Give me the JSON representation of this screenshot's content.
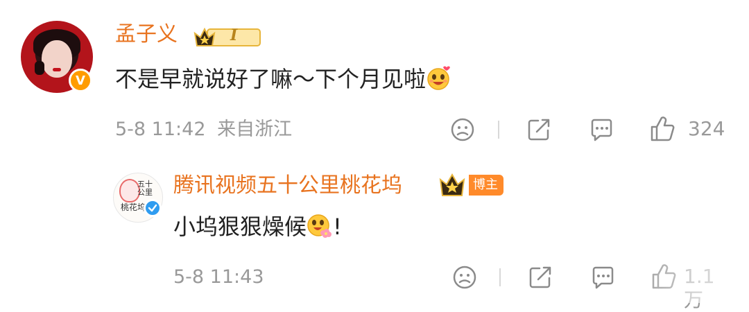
{
  "comment": {
    "author": "孟子义",
    "level_badge": "I",
    "text": "不是早就说好了嘛～下个月见啦",
    "time": "5-8 11:42",
    "location": "来自浙江",
    "likes": "324",
    "avatar_badge": "V"
  },
  "reply": {
    "author": "腾讯视频五十公里桃花坞",
    "author_tag": "博主",
    "text_before": "小坞狠狠燥候",
    "text_after": "!",
    "time": "5-8 11:43",
    "likes": "1.1万",
    "avatar_logo_top": "五十公里",
    "avatar_logo_bottom": "桃花坞"
  },
  "colors": {
    "name": "#e8731f",
    "meta": "#999999",
    "vip_orange": "#ff9c00",
    "verified_blue": "#2f9cf0",
    "blogger_badge": "#ff8a2a"
  },
  "icons": [
    "share-icon",
    "comment-icon",
    "like-icon",
    "crown-icon",
    "emoji-icon"
  ]
}
